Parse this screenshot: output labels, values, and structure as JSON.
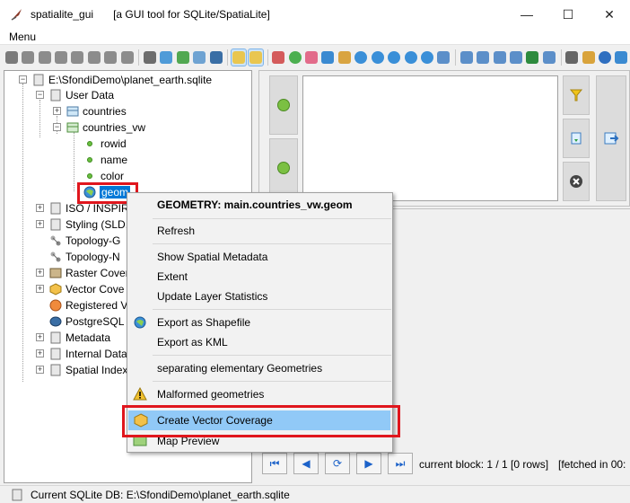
{
  "window": {
    "app_name": "spatialite_gui",
    "description": "[a GUI tool for SQLite/SpatiaLite]",
    "minimize": "—",
    "maximize": "☐",
    "close": "✕"
  },
  "menubar": {
    "menu_label": "Menu"
  },
  "toolbar": {
    "icons": [
      "connect-icon",
      "disconnect-icon",
      "db-icon",
      "db-icon",
      "db-icon",
      "db-icon",
      "db-icon",
      "db-icon",
      "attach-icon",
      "vacuum-icon",
      "sql-script-icon",
      "csv-icon",
      "postgres-icon",
      "tree-mode-icon",
      "tree-mode-icon",
      "chart-icon",
      "bug-icon",
      "shp-icon",
      "dbf-icon",
      "xl-icon",
      "globe-icon",
      "globe-icon",
      "globe-icon",
      "globe-icon",
      "globe-icon",
      "doc-icon",
      "doc-icon",
      "doc-icon",
      "doc-icon",
      "doc-icon",
      "excel-icon",
      "doc-icon",
      "binoculars-icon",
      "puzzle-icon",
      "help-icon",
      "exit-icon"
    ]
  },
  "tree": {
    "root": "E:\\SfondiDemo\\planet_earth.sqlite",
    "user_data": "User Data",
    "countries": "countries",
    "countries_vw": "countries_vw",
    "rowid": "rowid",
    "name": "name",
    "color": "color",
    "geom": "geom",
    "iso": "ISO / INSPIR",
    "styling": "Styling (SLD,",
    "topology_g": "Topology-G",
    "topology_n": "Topology-N",
    "raster": "Raster Cover",
    "vector": "Vector Cove",
    "registered": "Registered V",
    "postgresql": "PostgreSQL",
    "metadata": "Metadata",
    "internal": "Internal Data",
    "spatial_index": "Spatial Index"
  },
  "context_menu": {
    "header": "GEOMETRY: main.countries_vw.geom",
    "refresh": "Refresh",
    "show_spatial_metadata": "Show Spatial Metadata",
    "extent": "Extent",
    "update_layer_statistics": "Update Layer Statistics",
    "export_shapefile": "Export as Shapefile",
    "export_kml": "Export as KML",
    "separating": "separating elementary Geometries",
    "malformed": "Malformed geometries",
    "create_vector_coverage": "Create Vector Coverage",
    "map_preview": "Map Preview"
  },
  "results": {
    "current_block": "current block: 1 / 1 [0 rows]",
    "fetched": "[fetched in 00:"
  },
  "statusbar": {
    "text": "Current SQLite DB: E:\\SfondiDemo\\planet_earth.sqlite"
  },
  "colors": {
    "selection": "#0078d7",
    "highlight": "#91c9f7",
    "annotation_red": "#e0161d",
    "icon_green": "#6abf40"
  }
}
